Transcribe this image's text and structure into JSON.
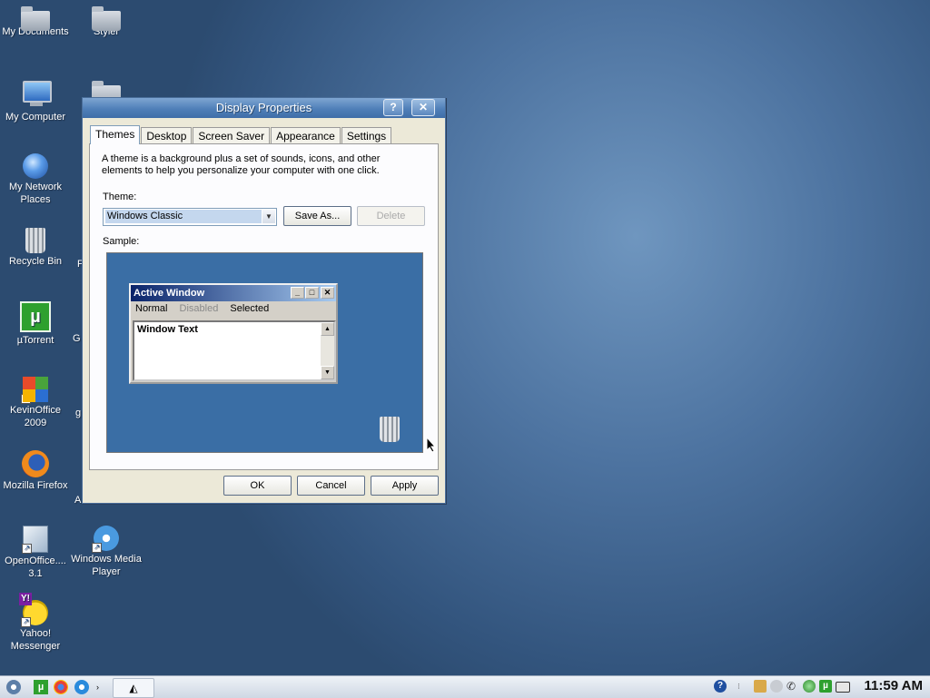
{
  "desktop": {
    "icons": [
      {
        "label": "My Documents"
      },
      {
        "label": "Styler"
      },
      {
        "label": "My Computer"
      },
      {
        "label": "My Network Places"
      },
      {
        "label": "Recycle Bin"
      },
      {
        "label": "µTorrent"
      },
      {
        "label": "KevinOffice 2009"
      },
      {
        "label": "Mozilla Firefox"
      },
      {
        "label": "OpenOffice.... 3.1"
      },
      {
        "label": "Windows Media Player"
      },
      {
        "label": "Yahoo! Messenger"
      }
    ],
    "partial_labels": [
      "F",
      "G",
      "g",
      "A"
    ]
  },
  "dialog": {
    "title": "Display Properties",
    "help_glyph": "?",
    "close_glyph": "✕",
    "tabs": [
      "Themes",
      "Desktop",
      "Screen Saver",
      "Appearance",
      "Settings"
    ],
    "active_tab": "Themes",
    "description": "A theme is a background plus a set of sounds, icons, and other elements to help you personalize your computer with one click.",
    "theme_label": "Theme:",
    "theme_value": "Windows Classic",
    "save_as": "Save As...",
    "delete": "Delete",
    "sample_label": "Sample:",
    "sample": {
      "window_title": "Active Window",
      "menu": [
        "Normal",
        "Disabled",
        "Selected"
      ],
      "window_text": "Window Text"
    },
    "ok": "OK",
    "cancel": "Cancel",
    "apply": "Apply"
  },
  "taskbar": {
    "clock": "11:59 AM"
  },
  "colors": {
    "desktop_bg": "#4d73a0",
    "sample_bg": "#3a6ea5",
    "active_title": "#0a246a"
  }
}
